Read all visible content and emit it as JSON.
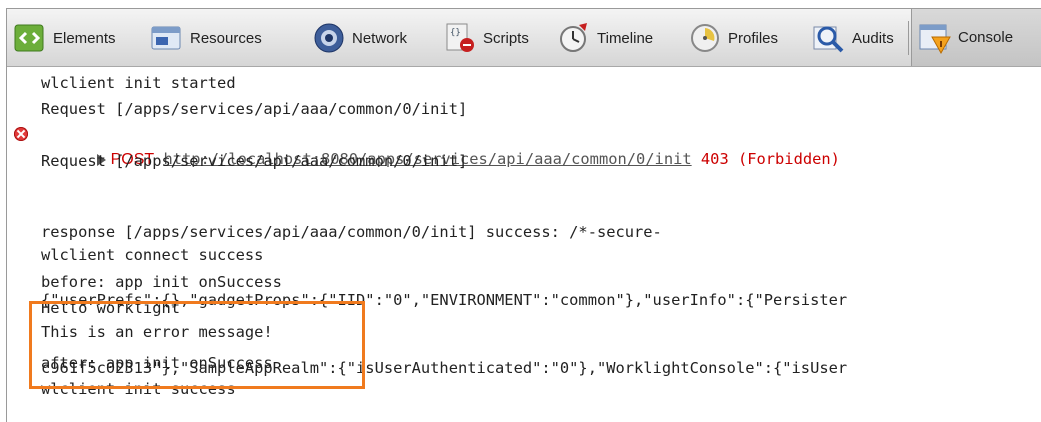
{
  "toolbar": {
    "tabs": [
      {
        "label": "Elements",
        "icon": "elements-icon"
      },
      {
        "label": "Resources",
        "icon": "resources-icon"
      },
      {
        "label": "Network",
        "icon": "network-icon"
      },
      {
        "label": "Scripts",
        "icon": "scripts-icon"
      },
      {
        "label": "Timeline",
        "icon": "timeline-icon"
      },
      {
        "label": "Profiles",
        "icon": "profiles-icon"
      },
      {
        "label": "Audits",
        "icon": "audits-icon"
      },
      {
        "label": "Console",
        "icon": "console-icon",
        "active": true
      }
    ]
  },
  "console": {
    "lines": [
      "wlclient init started",
      "Request [/apps/services/api/aaa/common/0/init]",
      "Request [/apps/services/api/aaa/common/0/init]",
      "wlclient connect success",
      "before: app init onSuccess",
      "Hello worklight",
      "This is an error message!",
      "after: app init onSuccess",
      "wlclient init success"
    ],
    "error": {
      "method": "POST",
      "url": "http://localhost:8080/apps/services/api/aaa/common/0/init",
      "status": "403 (Forbidden)"
    },
    "response": {
      "line1": "response [/apps/services/api/aaa/common/0/init] success: /*-secure-",
      "line2": "{\"userPrefs\":{},\"gadgetProps\":{\"IID\":\"0\",\"ENVIRONMENT\":\"common\"},\"userInfo\":{\"Persister",
      "line3": "c961f5c02313\"},\"SampleAppRealm\":{\"isUserAuthenticated\":\"0\"},\"WorklightConsole\":{\"isUser"
    }
  },
  "colors": {
    "highlight": "#f07a1e",
    "error": "#cc0000"
  }
}
